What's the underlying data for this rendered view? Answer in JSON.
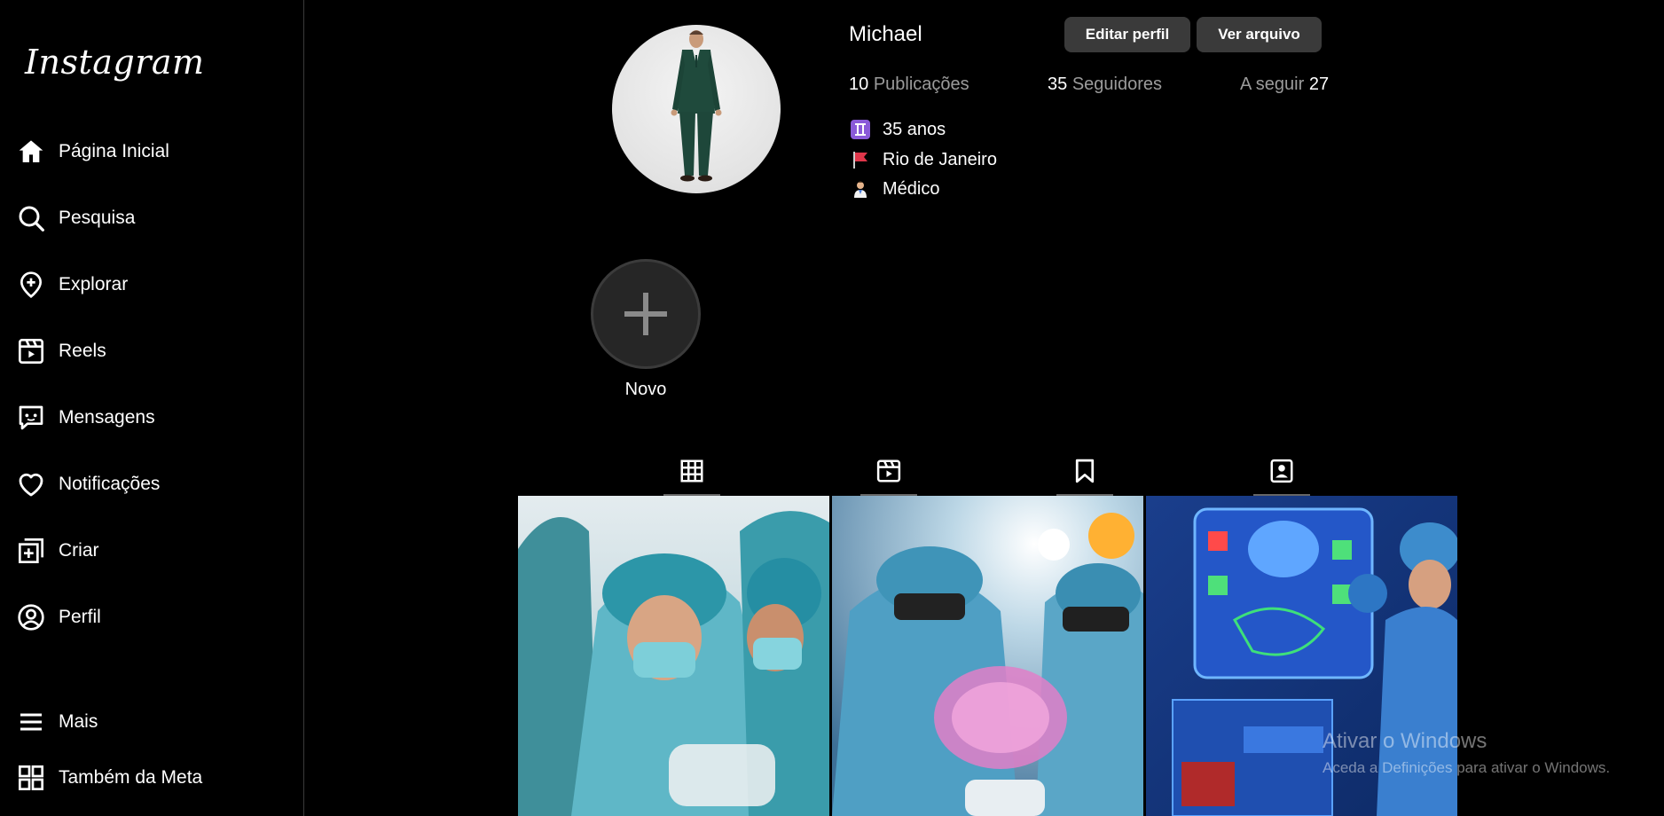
{
  "app": {
    "logo_text": "Instagram"
  },
  "sidebar": {
    "items": [
      {
        "label": "Página Inicial",
        "icon": "home-icon"
      },
      {
        "label": "Pesquisa",
        "icon": "search-icon"
      },
      {
        "label": "Explorar",
        "icon": "explore-icon"
      },
      {
        "label": "Reels",
        "icon": "reels-icon"
      },
      {
        "label": "Mensagens",
        "icon": "messages-icon"
      },
      {
        "label": "Notificações",
        "icon": "heart-icon"
      },
      {
        "label": "Criar",
        "icon": "create-icon"
      },
      {
        "label": "Perfil",
        "icon": "profile-icon"
      }
    ],
    "more": {
      "label": "Mais",
      "icon": "menu-icon"
    },
    "meta": {
      "label": "Também da Meta",
      "icon": "grid-apps-icon"
    }
  },
  "profile": {
    "username": "Michael",
    "edit_button": "Editar perfil",
    "archive_button": "Ver arquivo",
    "stats": {
      "posts_count": "10",
      "posts_label": "Publicações",
      "followers_count": "35",
      "followers_label": "Seguidores",
      "following_label": "A seguir",
      "following_count": "27"
    },
    "bio": [
      {
        "emoji": "gemini-icon",
        "text": "35 anos"
      },
      {
        "emoji": "flag-icon",
        "text": "Rio de Janeiro"
      },
      {
        "emoji": "doctor-icon",
        "text": "Médico"
      }
    ]
  },
  "highlights": {
    "new_label": "Novo"
  },
  "tabs": [
    "posts-grid-icon",
    "reels-tab-icon",
    "saved-icon",
    "tagged-icon"
  ],
  "posts": [
    {
      "alt": "surgeons-operating"
    },
    {
      "alt": "surgeons-vr-brain"
    },
    {
      "alt": "surgeon-holographic-brain"
    }
  ],
  "watermark": {
    "line1": "Ativar o Windows",
    "line2": "Aceda a Definições para ativar o Windows."
  },
  "colors": {
    "background": "#000000",
    "button": "#3a3a3a",
    "muted_text": "#9b9b9b",
    "divider": "#3a3a3a"
  }
}
